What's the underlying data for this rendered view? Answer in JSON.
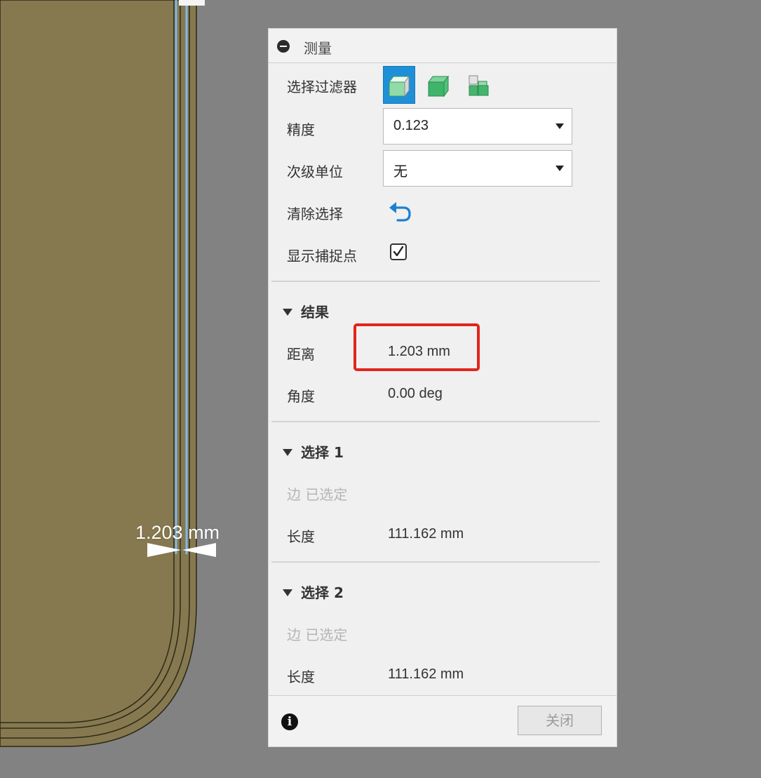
{
  "viewport": {
    "dimension_label": "1.203 mm"
  },
  "panel": {
    "title": "测量",
    "selection_filter": {
      "label": "选择过滤器",
      "options": [
        "body-filter-icon",
        "face-filter-icon",
        "edge-filter-icon"
      ],
      "active": "body-filter-icon"
    },
    "precision": {
      "label": "精度",
      "value": "0.123"
    },
    "secondary_unit": {
      "label": "次级单位",
      "value": "无"
    },
    "clear_selection": {
      "label": "清除选择"
    },
    "show_snap_points": {
      "label": "显示捕捉点",
      "checked": true
    },
    "results": {
      "heading": "结果",
      "distance_label": "距离",
      "distance_value": "1.203 mm",
      "angle_label": "角度",
      "angle_value": "0.00 deg"
    },
    "selection1": {
      "heading": "选择 1",
      "status": "边 已选定",
      "length_label": "长度",
      "length_value": "111.162 mm"
    },
    "selection2": {
      "heading": "选择 2",
      "status": "边 已选定",
      "length_label": "长度",
      "length_value": "111.162 mm"
    },
    "footer": {
      "close_label": "关闭"
    }
  },
  "colors": {
    "background": "#828282",
    "model_fill": "#857a52",
    "edge_highlight": "#6aa8d8",
    "active_filter": "#1e90d8",
    "highlight_box": "#e1251b",
    "undo_icon": "#1e7fd0"
  }
}
